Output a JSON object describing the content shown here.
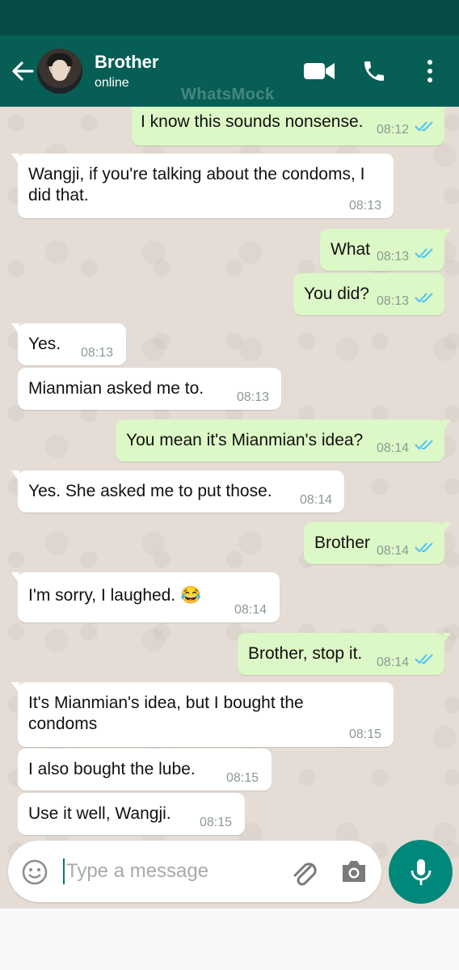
{
  "header": {
    "contact_name": "Brother",
    "status": "online",
    "watermark": "WhatsMock",
    "icons": [
      "back-arrow-icon",
      "video-call-icon",
      "voice-call-icon",
      "more-options-icon"
    ]
  },
  "messages": [
    {
      "dir": "out",
      "text": "I know this sounds nonsense.",
      "time": "08:12",
      "ticks": true
    },
    {
      "dir": "in",
      "text": "Wangji, if you're talking about the condoms, I\ndid that.",
      "time": "08:13"
    },
    {
      "dir": "out",
      "text": "What",
      "time": "08:13",
      "ticks": true
    },
    {
      "dir": "out",
      "text": "You did?",
      "time": "08:13",
      "ticks": true
    },
    {
      "dir": "in",
      "text": "Yes.",
      "time": "08:13"
    },
    {
      "dir": "in",
      "text": "Mianmian asked me to.",
      "time": "08:13"
    },
    {
      "dir": "out",
      "text": "You mean it's Mianmian's idea?",
      "time": "08:14",
      "ticks": true
    },
    {
      "dir": "in",
      "text": "Yes. She asked me to put those.",
      "time": "08:14"
    },
    {
      "dir": "out",
      "text": "Brother",
      "time": "08:14",
      "ticks": true
    },
    {
      "dir": "in",
      "text": "I'm sorry, I laughed. 😂",
      "time": "08:14"
    },
    {
      "dir": "out",
      "text": "Brother, stop it.",
      "time": "08:14",
      "ticks": true
    },
    {
      "dir": "in",
      "text": "It's Mianmian's idea, but I bought the\ncondoms",
      "time": "08:15"
    },
    {
      "dir": "in",
      "text": "I also bought the lube.",
      "time": "08:15"
    },
    {
      "dir": "in",
      "text": "Use it well, Wangji.",
      "time": "08:15"
    }
  ],
  "input": {
    "placeholder": "Type a message",
    "icons": [
      "emoji-icon",
      "attach-icon",
      "camera-icon",
      "mic-icon"
    ]
  },
  "colors": {
    "status_bar": "#054d44",
    "header": "#075e54",
    "chat_bg": "#e5ddd5",
    "outgoing_bubble": "#dcf8c6",
    "incoming_bubble": "#ffffff",
    "read_ticks": "#4fc3f7",
    "mic_button": "#00897b"
  }
}
